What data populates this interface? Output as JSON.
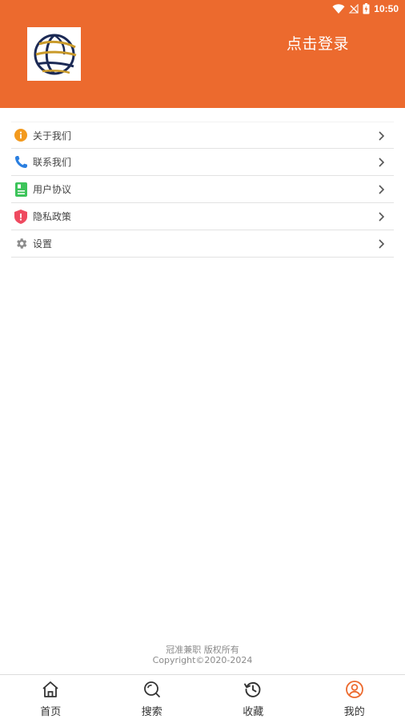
{
  "status_bar": {
    "time": "10:50"
  },
  "header": {
    "login_label": "点击登录",
    "accent_color": "#ec6a2e"
  },
  "menu": {
    "items": [
      {
        "label": "关于我们",
        "icon": "info-icon"
      },
      {
        "label": "联系我们",
        "icon": "phone-icon"
      },
      {
        "label": "用户协议",
        "icon": "document-icon"
      },
      {
        "label": "隐私政策",
        "icon": "shield-icon"
      },
      {
        "label": "设置",
        "icon": "gear-icon"
      }
    ]
  },
  "footer": {
    "line1": "冠准兼职  版权所有",
    "line2": "Copyright©2020-2024"
  },
  "tabbar": {
    "active_tab": "我的",
    "tabs": [
      {
        "label": "首页",
        "icon": "home-icon"
      },
      {
        "label": "搜索",
        "icon": "search-icon"
      },
      {
        "label": "收藏",
        "icon": "history-icon"
      },
      {
        "label": "我的",
        "icon": "user-icon"
      }
    ]
  }
}
